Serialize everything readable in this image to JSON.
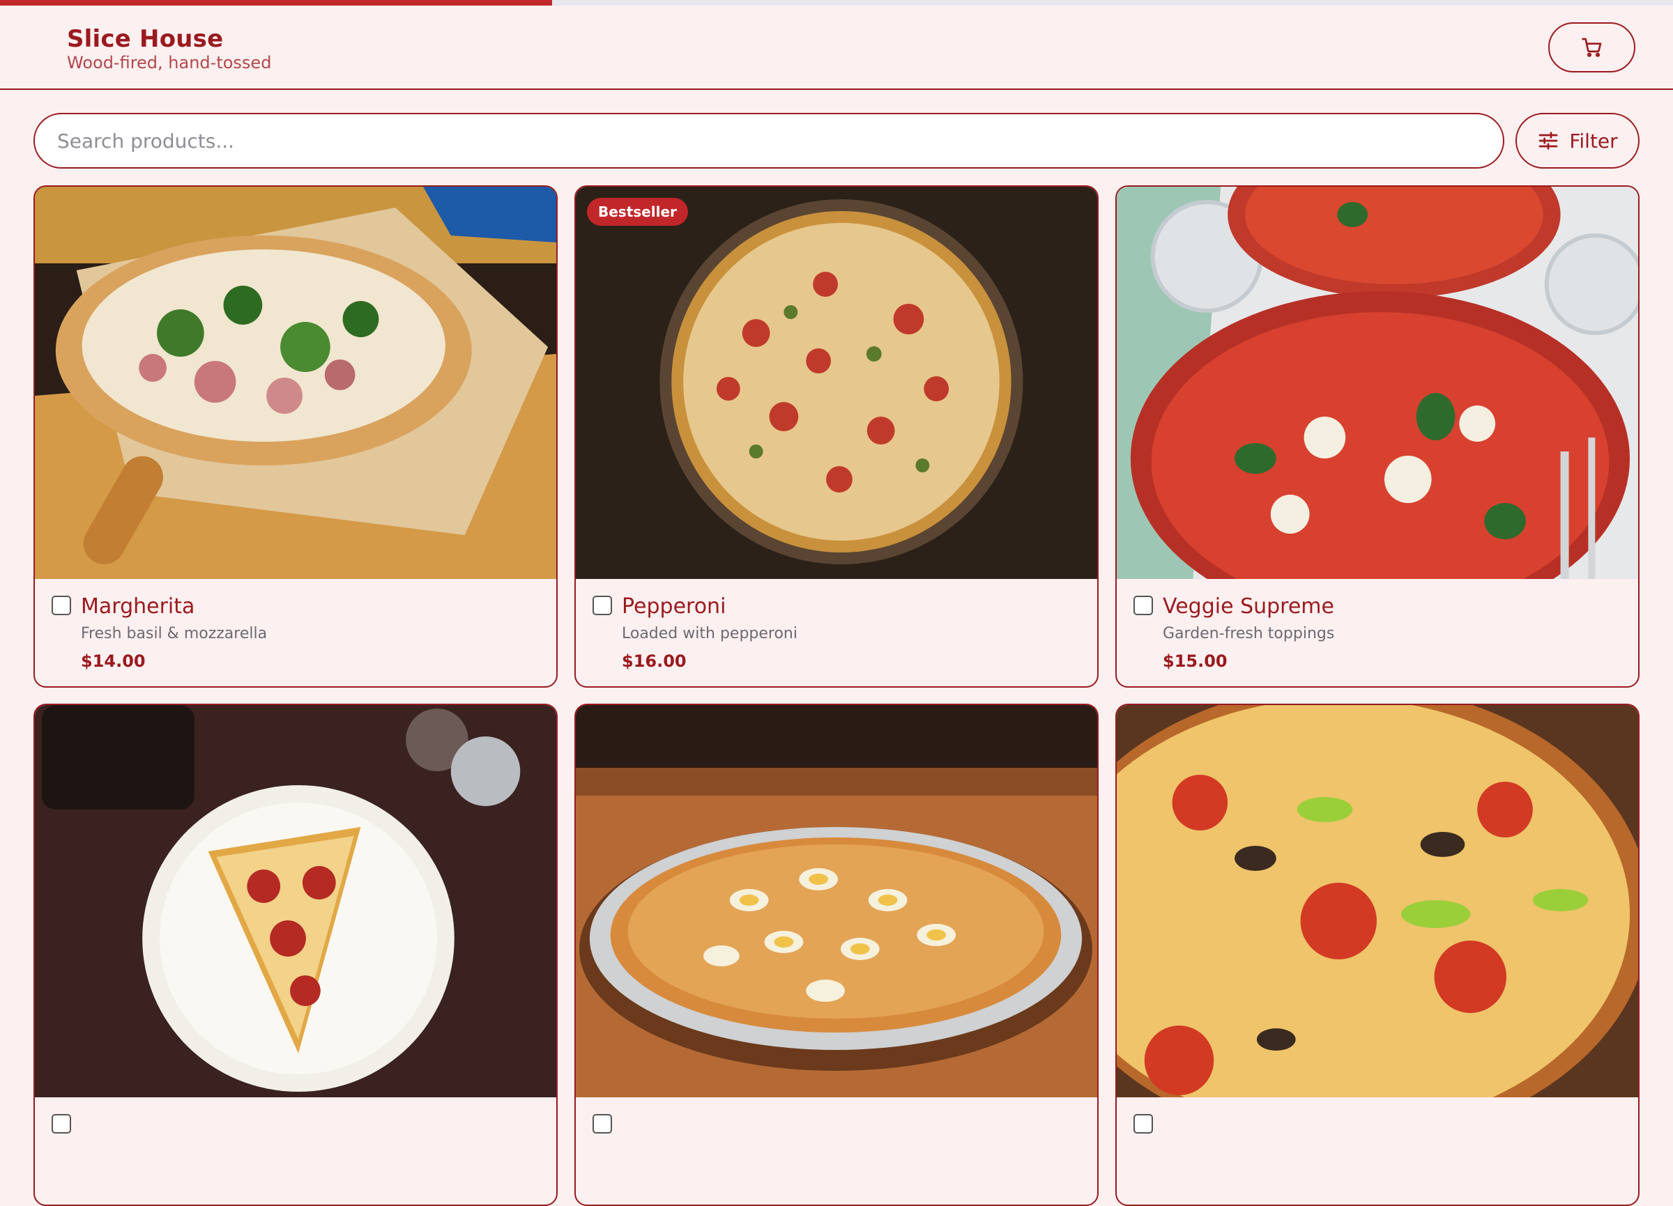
{
  "progress": {
    "percent": 33
  },
  "header": {
    "title": "Slice House",
    "tagline": "Wood-fired, hand-tossed",
    "cart_icon": "cart-icon"
  },
  "search": {
    "placeholder": "Search products..."
  },
  "filter": {
    "label": "Filter",
    "icon": "sliders-icon"
  },
  "colors": {
    "accent": "#9a1a1f",
    "background": "#fdf0f0",
    "badge": "#c1262a"
  },
  "products": [
    {
      "name": "Margherita",
      "description": "Fresh basil & mozzarella",
      "price": "$14.00",
      "badge": ""
    },
    {
      "name": "Pepperoni",
      "description": "Loaded with pepperoni",
      "price": "$16.00",
      "badge": "Bestseller"
    },
    {
      "name": "Veggie Supreme",
      "description": "Garden-fresh toppings",
      "price": "$15.00",
      "badge": ""
    },
    {
      "name": "",
      "description": "",
      "price": "",
      "badge": ""
    },
    {
      "name": "",
      "description": "",
      "price": "",
      "badge": ""
    },
    {
      "name": "",
      "description": "",
      "price": "",
      "badge": ""
    }
  ]
}
